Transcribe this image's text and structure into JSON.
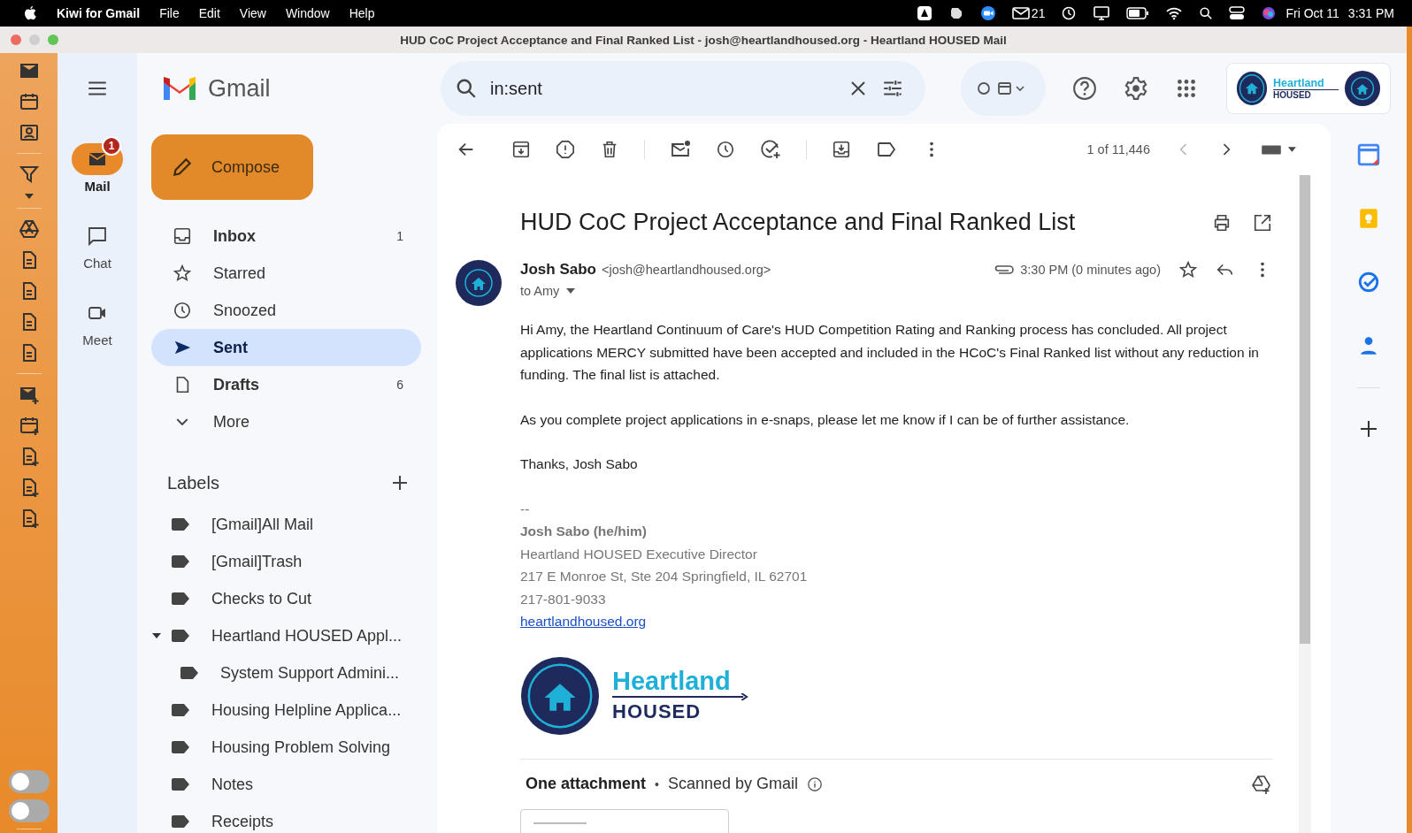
{
  "menubar": {
    "app": "Kiwi for Gmail",
    "menus": [
      "File",
      "Edit",
      "View",
      "Window",
      "Help"
    ],
    "mail_count": "21",
    "date": "Fri Oct 11",
    "time": "3:31 PM"
  },
  "window": {
    "title": "HUD CoC Project Acceptance and Final Ranked List - josh@heartlandhoused.org - Heartland HOUSED Mail"
  },
  "kiwi_toggles": [
    {
      "on": false
    },
    {
      "on": false
    }
  ],
  "rail": [
    {
      "label": "Mail",
      "selected": true,
      "badge": "1"
    },
    {
      "label": "Chat",
      "selected": false
    },
    {
      "label": "Meet",
      "selected": false
    }
  ],
  "brand": "Gmail",
  "search": {
    "value": "in:sent"
  },
  "account": {
    "logo_top": "Heartland",
    "logo_bottom": "HOUSED"
  },
  "compose": "Compose",
  "folders": [
    {
      "kind": "inbox",
      "label": "Inbox",
      "count": "1",
      "unread": true,
      "selected": false
    },
    {
      "kind": "starred",
      "label": "Starred",
      "unread": false,
      "selected": false
    },
    {
      "kind": "snoozed",
      "label": "Snoozed",
      "unread": false,
      "selected": false
    },
    {
      "kind": "sent",
      "label": "Sent",
      "unread": false,
      "selected": true
    },
    {
      "kind": "drafts",
      "label": "Drafts",
      "count": "6",
      "unread": true,
      "selected": false
    },
    {
      "kind": "more",
      "label": "More",
      "unread": false,
      "selected": false
    }
  ],
  "labels_heading": "Labels",
  "labels": [
    {
      "name": "[Gmail]All Mail"
    },
    {
      "name": "[Gmail]Trash"
    },
    {
      "name": "Checks to Cut"
    },
    {
      "name": "Heartland HOUSED Appl...",
      "expanded": true,
      "children": [
        {
          "name": "System Support Admini..."
        }
      ]
    },
    {
      "name": "Housing Helpline Applica..."
    },
    {
      "name": "Housing Problem Solving"
    },
    {
      "name": "Notes"
    },
    {
      "name": "Receipts"
    }
  ],
  "toolbar": {
    "counter": "1 of 11,446"
  },
  "email": {
    "subject": "HUD CoC Project Acceptance and Final Ranked List",
    "sender_name": "Josh Sabo",
    "sender_email": "<josh@heartlandhoused.org>",
    "time": "3:30 PM (0 minutes ago)",
    "to": "to Amy",
    "body": [
      "Hi Amy, the Heartland Continuum of Care's HUD Competition Rating and Ranking process has concluded. All project applications MERCY submitted have been accepted and included in the HCoC's Final Ranked list without any reduction in funding. The final list is attached.",
      "As you complete project applications in e-snaps, please let me know if I can be of further assistance.",
      "Thanks, Josh Sabo"
    ],
    "signature": {
      "dash": "--",
      "name": "Josh Sabo (he/him)",
      "lines": [
        "Heartland HOUSED Executive Director",
        "217 E Monroe St, Ste 204 Springfield, IL 62701",
        "217-801-9033"
      ],
      "link": "heartlandhoused.org",
      "logo_top": "Heartland",
      "logo_bottom": "HOUSED"
    },
    "attachments": {
      "heading": "One attachment",
      "separator": "•",
      "scan_note": "Scanned by Gmail"
    }
  }
}
